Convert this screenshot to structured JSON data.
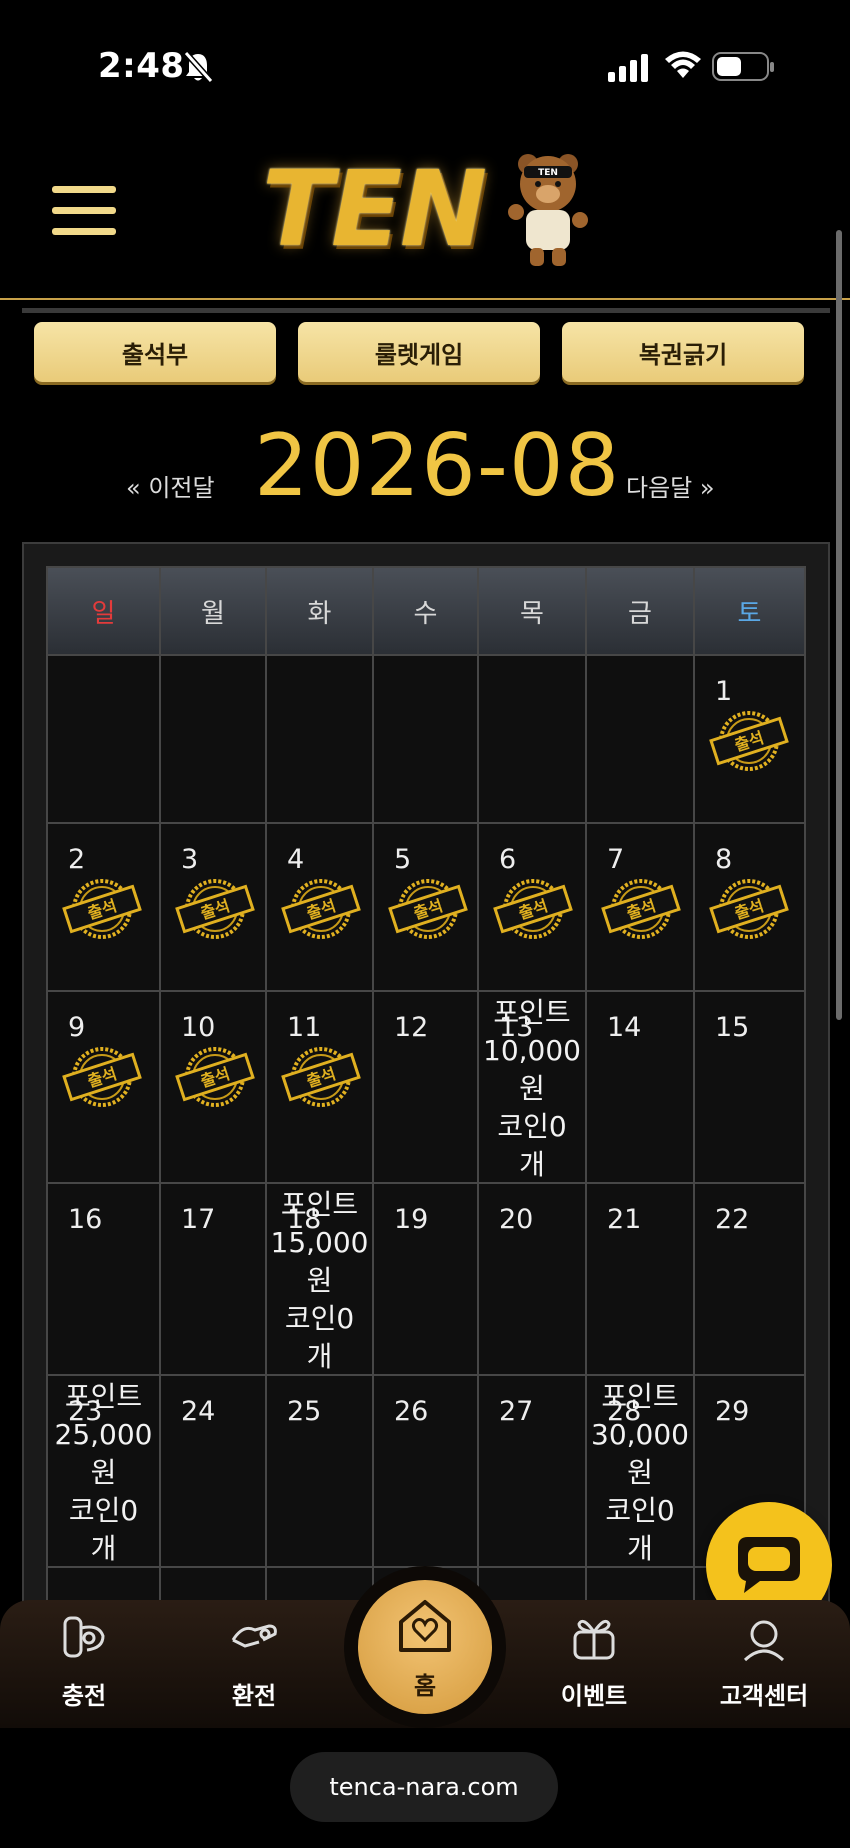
{
  "status_bar": {
    "time": "2:48",
    "icons": [
      "bell-off-icon",
      "signal-icon",
      "wifi-icon",
      "battery-icon"
    ]
  },
  "header": {
    "logo_text": "TEN",
    "bear_badge": "TEN"
  },
  "tabs": [
    "출석부",
    "룰렛게임",
    "복권긁기"
  ],
  "month_nav": {
    "prev": "« 이전달",
    "title": "2026-08",
    "next": "다음달 »"
  },
  "calendar": {
    "weekdays": [
      "일",
      "월",
      "화",
      "수",
      "목",
      "금",
      "토"
    ],
    "stamp_text": "출석",
    "days": {
      "1": "1",
      "2": "2",
      "3": "3",
      "4": "4",
      "5": "5",
      "6": "6",
      "7": "7",
      "8": "8",
      "9": "9",
      "10": "10",
      "11": "11",
      "12": "12",
      "13": "13",
      "14": "14",
      "15": "15",
      "16": "16",
      "17": "17",
      "18": "18",
      "19": "19",
      "20": "20",
      "21": "21",
      "22": "22",
      "23": "23",
      "24": "24",
      "25": "25",
      "26": "26",
      "27": "27",
      "28": "28",
      "29": "29"
    },
    "rewards": {
      "13": [
        "포인트",
        "10,000",
        "원",
        "코인0",
        "개"
      ],
      "18": [
        "포인트",
        "15,000",
        "원",
        "코인0",
        "개"
      ],
      "23": [
        "포인트",
        "25,000",
        "원",
        "코인0",
        "개"
      ],
      "28": [
        "포인트",
        "30,000",
        "원",
        "코인0",
        "개"
      ]
    }
  },
  "bottom_nav": {
    "charge": "충전",
    "exchange": "환전",
    "home": "홈",
    "event": "이벤트",
    "support": "고객센터"
  },
  "url": "tenca-nara.com",
  "colors": {
    "gold": "#f0c544",
    "button": "#f0d68f",
    "sunday": "#e33b3b",
    "saturday": "#5aa8e6",
    "chat": "#f4c21c"
  }
}
